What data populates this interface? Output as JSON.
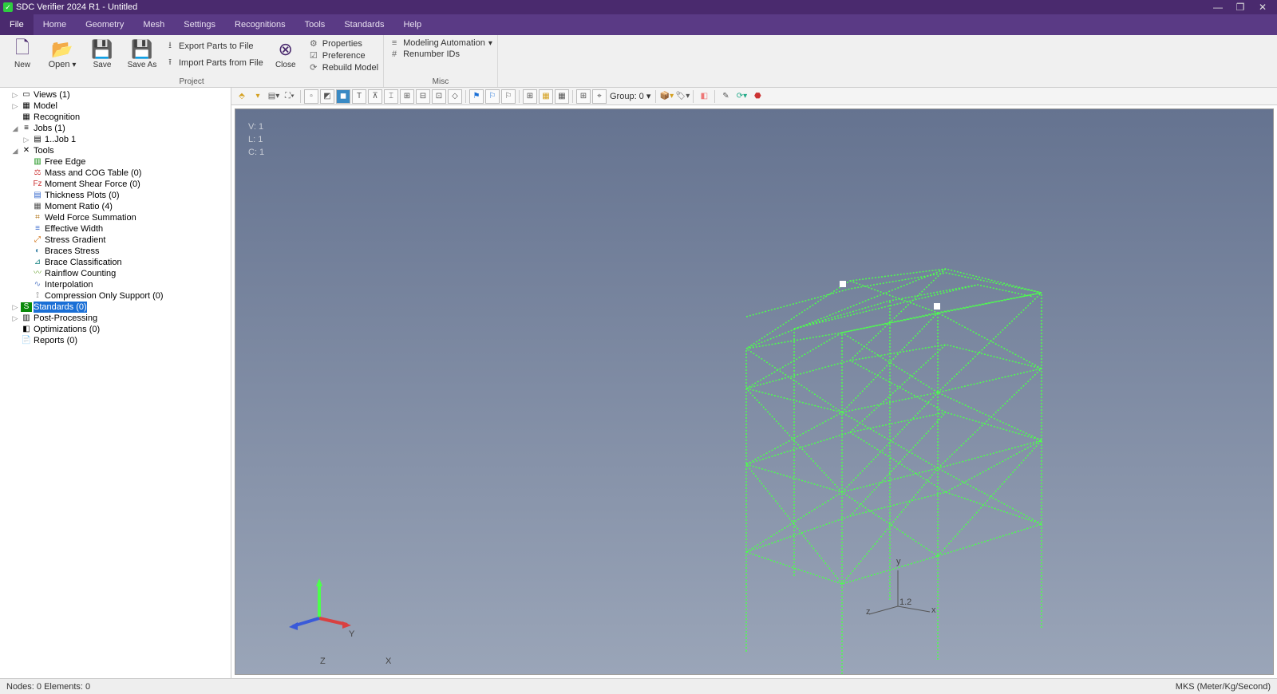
{
  "titlebar": {
    "app": "SDC Verifier 2024 R1",
    "doc": "Untitled"
  },
  "winbuttons": {
    "min": "—",
    "max": "❐",
    "close": "✕"
  },
  "menus": [
    "File",
    "Home",
    "Geometry",
    "Mesh",
    "Settings",
    "Recognitions",
    "Tools",
    "Standards",
    "Help"
  ],
  "ribbon": {
    "new": "New",
    "open": "Open",
    "save": "Save",
    "saveas": "Save As",
    "close": "Close",
    "exportParts": "Export Parts to File",
    "importParts": "Import Parts from File",
    "properties": "Properties",
    "preference": "Preference",
    "rebuild": "Rebuild Model",
    "modelAuto": "Modeling Automation",
    "renumber": "Renumber IDs",
    "group1": "Project",
    "group2": "Misc"
  },
  "tree": {
    "views": "Views (1)",
    "model": "Model",
    "recognition": "Recognition",
    "jobs": "Jobs (1)",
    "job1": "1..Job 1",
    "tools": "Tools",
    "toolsItems": [
      "Free Edge",
      "Mass and COG Table (0)",
      "Moment Shear Force (0)",
      "Thickness Plots (0)",
      "Moment Ratio (4)",
      "Weld Force Summation",
      "Effective Width",
      "Stress Gradient",
      "Braces Stress",
      "Brace Classification",
      "Rainflow Counting",
      "Interpolation",
      "Compression Only Support (0)"
    ],
    "standards": "Standards (0)",
    "postproc": "Post-Processing",
    "optim": "Optimizations (0)",
    "reports": "Reports (0)"
  },
  "viewport": {
    "v": "V: 1",
    "l": "L: 1",
    "c": "C: 1",
    "groupLabel": "Group: 0",
    "axisX": "X",
    "axisY": "Y",
    "axisZ": "Z",
    "axisx": "x",
    "axisy": "y",
    "axisz": "z",
    "axisnum": "1.2"
  },
  "status": {
    "left": "Nodes: 0  Elements: 0",
    "right": "MKS (Meter/Kg/Second)"
  }
}
